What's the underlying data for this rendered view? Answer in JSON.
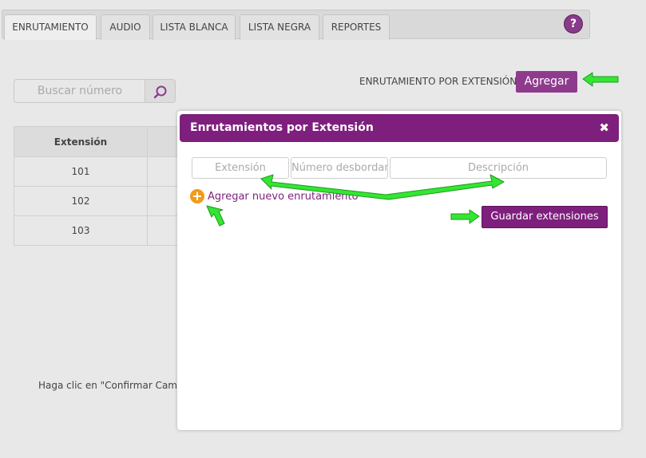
{
  "tabs": [
    {
      "label": "ENRUTAMIENTO",
      "active": true
    },
    {
      "label": "AUDIO",
      "active": false
    },
    {
      "label": "LISTA BLANCA",
      "active": false
    },
    {
      "label": "LISTA NEGRA",
      "active": false
    },
    {
      "label": "REPORTES",
      "active": false
    }
  ],
  "help": {
    "label": "?"
  },
  "header": {
    "route_label": "ENRUTAMIENTO POR EXTENSIÓN",
    "add_button": "Agregar"
  },
  "search": {
    "placeholder": "Buscar número",
    "icon": "search-icon"
  },
  "table": {
    "header": "Extensión",
    "rows": [
      "101",
      "102",
      "103"
    ]
  },
  "note": "Haga clic en \"Confirmar Camb",
  "modal": {
    "title": "Enrutamientos por Extensión",
    "close": "✖",
    "fields": {
      "extension_placeholder": "Extensión",
      "overflow_placeholder": "Número desbordamiento",
      "description_placeholder": "Descripción"
    },
    "add_new_link": "Agregar nuevo enrutamiento",
    "add_icon": "+",
    "save_button": "Guardar extensiones"
  },
  "colors": {
    "accent": "#7e1f7e",
    "button": "#8e3b8e",
    "plus": "#f29a1a",
    "arrow": "#33e633"
  }
}
